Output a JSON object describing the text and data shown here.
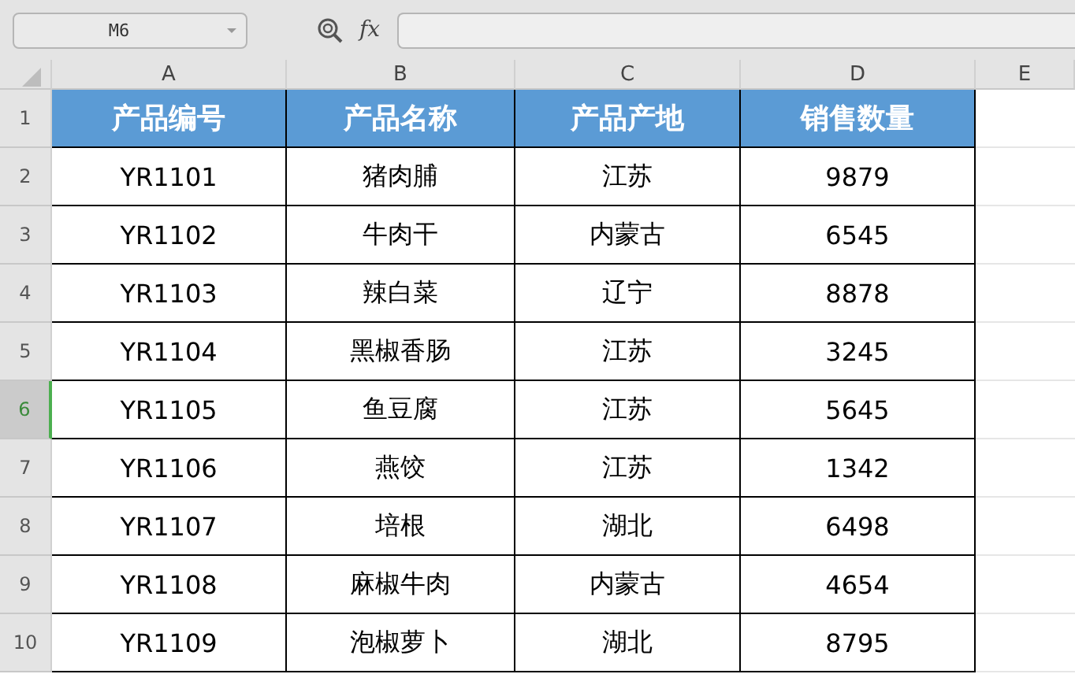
{
  "formula_bar": {
    "name_box": "M6",
    "fx_label": "fx"
  },
  "columns": [
    {
      "label": "A"
    },
    {
      "label": "B"
    },
    {
      "label": "C"
    },
    {
      "label": "D"
    },
    {
      "label": "E"
    }
  ],
  "rows": [
    {
      "number": "1",
      "selected": false,
      "kind": "header",
      "cells": [
        "产品编号",
        "产品名称",
        "产品产地",
        "销售数量"
      ]
    },
    {
      "number": "2",
      "selected": false,
      "kind": "data",
      "cells": [
        "YR1101",
        "猪肉脯",
        "江苏",
        "9879"
      ]
    },
    {
      "number": "3",
      "selected": false,
      "kind": "data",
      "cells": [
        "YR1102",
        "牛肉干",
        "内蒙古",
        "6545"
      ]
    },
    {
      "number": "4",
      "selected": false,
      "kind": "data",
      "cells": [
        "YR1103",
        "辣白菜",
        "辽宁",
        "8878"
      ]
    },
    {
      "number": "5",
      "selected": false,
      "kind": "data",
      "cells": [
        "YR1104",
        "黑椒香肠",
        "江苏",
        "3245"
      ]
    },
    {
      "number": "6",
      "selected": true,
      "kind": "data",
      "cells": [
        "YR1105",
        "鱼豆腐",
        "江苏",
        "5645"
      ]
    },
    {
      "number": "7",
      "selected": false,
      "kind": "data",
      "cells": [
        "YR1106",
        "燕饺",
        "江苏",
        "1342"
      ]
    },
    {
      "number": "8",
      "selected": false,
      "kind": "data",
      "cells": [
        "YR1107",
        "培根",
        "湖北",
        "6498"
      ]
    },
    {
      "number": "9",
      "selected": false,
      "kind": "data",
      "cells": [
        "YR1108",
        "麻椒牛肉",
        "内蒙古",
        "4654"
      ]
    },
    {
      "number": "10",
      "selected": false,
      "kind": "data",
      "cells": [
        "YR1109",
        "泡椒萝卜",
        "湖北",
        "8795"
      ]
    }
  ]
}
